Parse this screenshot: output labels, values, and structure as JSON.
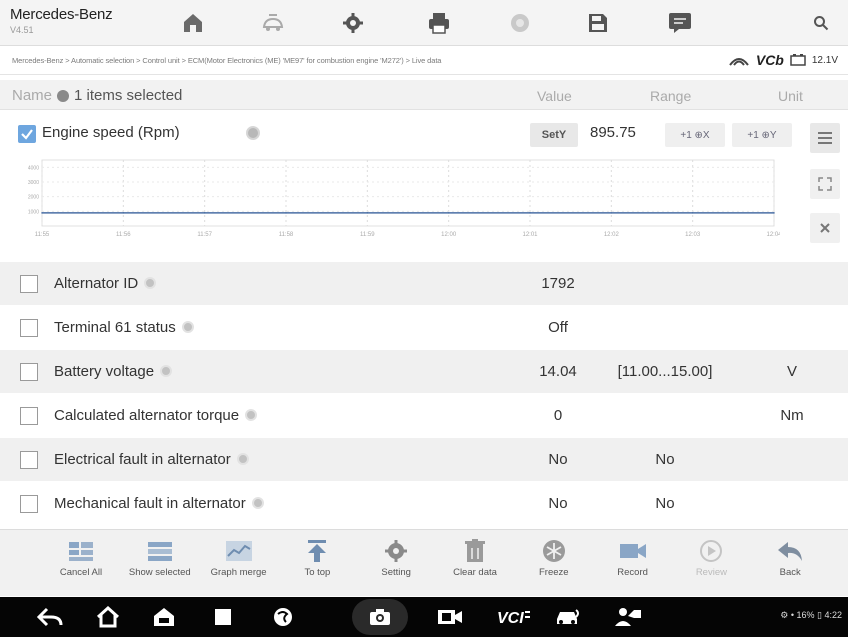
{
  "app": {
    "title": "Mercedes-Benz",
    "version": "V4.51"
  },
  "toolbar": {
    "icons": [
      "home-icon",
      "vehicle-swap-icon",
      "settings-icon",
      "print-icon",
      "help-icon",
      "save-icon",
      "message-icon",
      "search-icon"
    ]
  },
  "breadcrumb": "Mercedes-Benz > Automatic selection > Control unit > ECM(Motor Electronics (ME) 'ME97' for combustion engine 'M272') > Live data",
  "vci": {
    "label": "VCb",
    "battery": "12.1V"
  },
  "header": {
    "name_label": "Name",
    "selected": "1 items selected",
    "value": "Value",
    "range": "Range",
    "unit": "Unit"
  },
  "graph": {
    "title": "Engine speed  (Rpm)",
    "sety_label": "SetY",
    "value": "895.75",
    "zoom_x": "+1 ⊕X",
    "zoom_y": "+1 ⊕Y"
  },
  "chart_data": {
    "type": "line",
    "title": "Engine speed (Rpm)",
    "x": [
      "11:55",
      "11:56",
      "11:57",
      "11:58",
      "11:59",
      "12:00",
      "12:01",
      "12:02",
      "12:03",
      "12:04"
    ],
    "series": [
      {
        "values": [
          895,
          896,
          896,
          895,
          896,
          895,
          896,
          895,
          896,
          895
        ]
      }
    ],
    "ylim": [
      0,
      4500
    ],
    "ytick_labels": [
      "1000",
      "2000",
      "3000",
      "4000"
    ],
    "grid": true
  },
  "rows": [
    {
      "name": "Alternator ID",
      "value": "1792",
      "range": "",
      "unit": ""
    },
    {
      "name": "Terminal 61 status",
      "value": "Off",
      "range": "",
      "unit": ""
    },
    {
      "name": "Battery voltage",
      "value": "14.04",
      "range": "[11.00...15.00]",
      "unit": "V"
    },
    {
      "name": "Calculated alternator torque",
      "value": "0",
      "range": "",
      "unit": "Nm"
    },
    {
      "name": "Electrical fault in alternator",
      "value": "No",
      "range": "No",
      "unit": ""
    },
    {
      "name": "Mechanical fault in alternator",
      "value": "No",
      "range": "No",
      "unit": ""
    }
  ],
  "functions": [
    {
      "label": "Cancel All",
      "icon": "cancel-all-icon"
    },
    {
      "label": "Show selected",
      "icon": "show-selected-icon"
    },
    {
      "label": "Graph merge",
      "icon": "graph-merge-icon"
    },
    {
      "label": "To top",
      "icon": "to-top-icon"
    },
    {
      "label": "Setting",
      "icon": "setting-icon"
    },
    {
      "label": "Clear data",
      "icon": "clear-data-icon"
    },
    {
      "label": "Freeze",
      "icon": "freeze-icon"
    },
    {
      "label": "Record",
      "icon": "record-icon"
    },
    {
      "label": "Review",
      "icon": "review-icon"
    },
    {
      "label": "Back",
      "icon": "back-icon"
    }
  ],
  "android": {
    "status": "⚙ • 16% ▯ 4:22"
  },
  "colors": {
    "checkbox_checked": "#6ea6df",
    "plot_line": "#4a6fa5",
    "row_alt": "#f0f0f0"
  }
}
